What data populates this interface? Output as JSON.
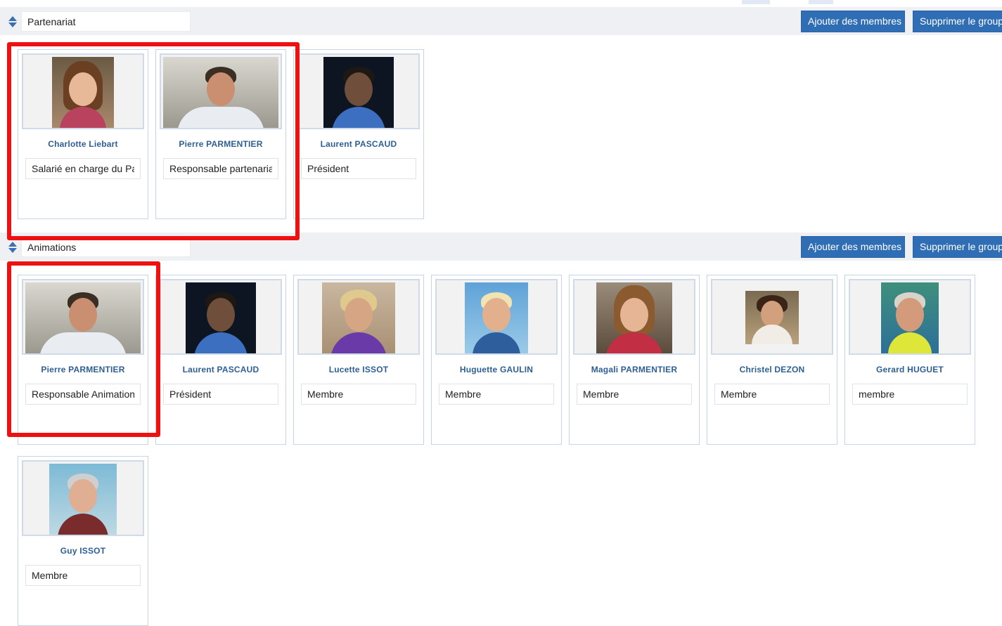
{
  "groups": [
    {
      "name": "Partenariat",
      "add_label": "Ajouter des membres",
      "delete_label": "Supprimer le groupe",
      "members": [
        {
          "name": "Charlotte Liebart",
          "role": "Salarié en charge du Partenariat"
        },
        {
          "name": "Pierre PARMENTIER",
          "role": "Responsable partenariat"
        },
        {
          "name": "Laurent PASCAUD",
          "role": "Président"
        }
      ]
    },
    {
      "name": "Animations",
      "add_label": "Ajouter des membres",
      "delete_label": "Supprimer le groupe",
      "members": [
        {
          "name": "Pierre PARMENTIER",
          "role": "Responsable Animations"
        },
        {
          "name": "Laurent PASCAUD",
          "role": "Président"
        },
        {
          "name": "Lucette ISSOT",
          "role": "Membre"
        },
        {
          "name": "Huguette GAULIN",
          "role": "Membre"
        },
        {
          "name": "Magali PARMENTIER",
          "role": "Membre"
        },
        {
          "name": "Christel DEZON",
          "role": "Membre"
        },
        {
          "name": "Gerard HUGUET",
          "role": "membre"
        },
        {
          "name": "Guy ISSOT",
          "role": "Membre"
        }
      ]
    }
  ],
  "colors": {
    "button": "#2f6eb5",
    "name_text": "#2d5f96",
    "highlight": "#ee1111",
    "header_bg": "#eef0f3"
  },
  "icons": {
    "group_sort": "sort-arrows-icon",
    "member_photo": "member-photo"
  }
}
